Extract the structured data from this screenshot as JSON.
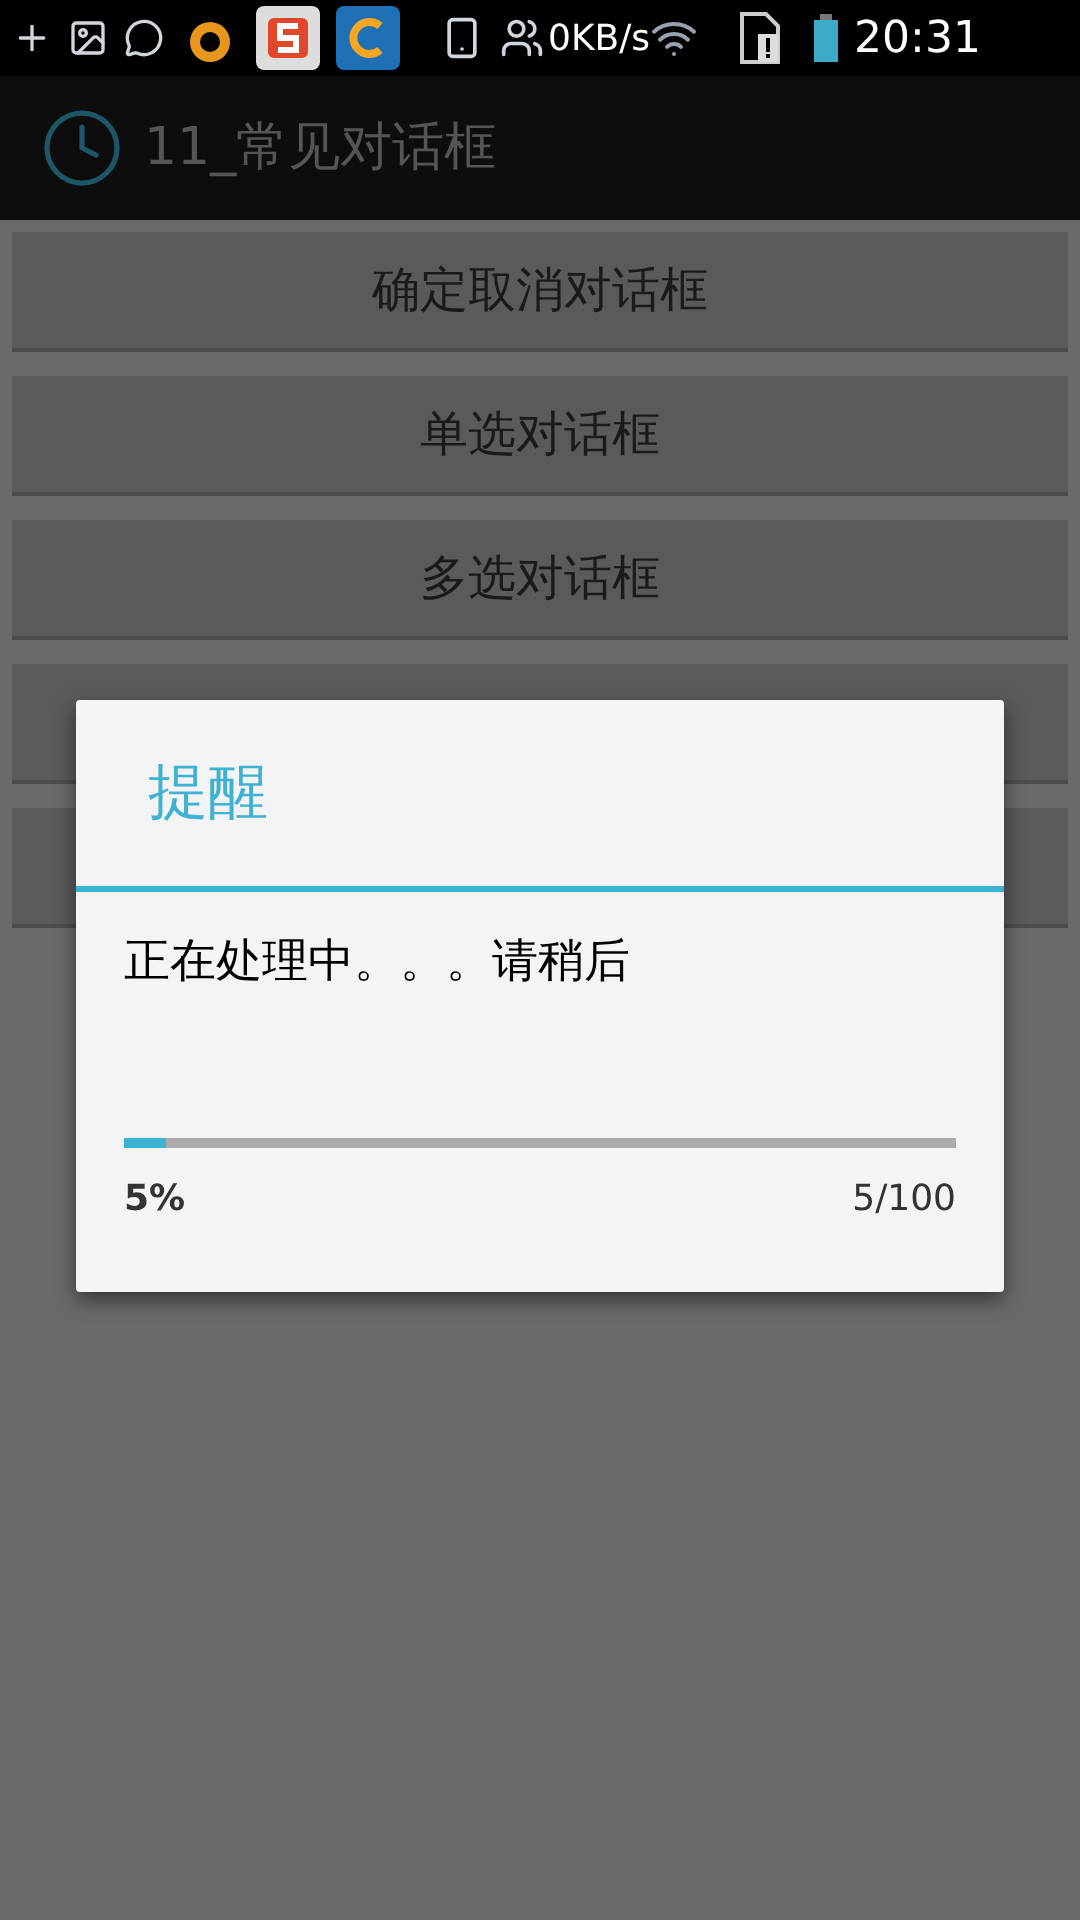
{
  "status_bar": {
    "network_speed": "0KB/s",
    "time": "20:31"
  },
  "action_bar": {
    "title": "11_常见对话框"
  },
  "buttons": [
    {
      "kind": "labeled",
      "label": "确定取消对话框"
    },
    {
      "kind": "labeled",
      "label": "单选对话框"
    },
    {
      "kind": "labeled",
      "label": "多选对话框"
    },
    {
      "kind": "covered"
    },
    {
      "kind": "covered"
    }
  ],
  "dialog": {
    "title": "提醒",
    "message": "正在处理中。。。请稍后",
    "progress": {
      "level": 0.05,
      "percent": "5%",
      "count": "5/100"
    }
  }
}
